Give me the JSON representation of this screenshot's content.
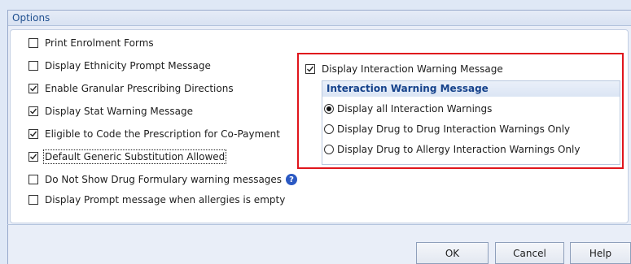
{
  "header": {
    "title": "Options"
  },
  "options": [
    {
      "label": "Print Enrolment Forms",
      "checked": false
    },
    {
      "label": "Display Ethnicity Prompt Message",
      "checked": false
    },
    {
      "label": "Enable Granular Prescribing Directions",
      "checked": true
    },
    {
      "label": "Display Stat Warning Message",
      "checked": true
    },
    {
      "label": "Eligible to Code the Prescription for Co-Payment",
      "checked": true
    },
    {
      "label": "Default Generic Substitution Allowed",
      "checked": true
    },
    {
      "label": "Do Not Show Drug Formulary warning messages",
      "checked": false
    },
    {
      "label": "Display Prompt message when allergies is empty",
      "checked": false
    }
  ],
  "help_icon": {
    "icon": "question-circle-icon",
    "glyph": "?"
  },
  "interaction": {
    "toggle_label": "Display Interaction Warning Message",
    "toggle_checked": true,
    "group_title": "Interaction Warning Message",
    "radios": [
      {
        "label": "Display all Interaction Warnings",
        "selected": true
      },
      {
        "label": "Display Drug to Drug Interaction Warnings Only",
        "selected": false
      },
      {
        "label": "Display Drug to Allergy Interaction Warnings Only",
        "selected": false
      }
    ]
  },
  "buttons": {
    "ok": "OK",
    "cancel": "Cancel",
    "help": "Help"
  },
  "colors": {
    "highlight_border": "#e0151c",
    "header_text": "#1f4f8f",
    "help_icon": "#2b59c3"
  }
}
